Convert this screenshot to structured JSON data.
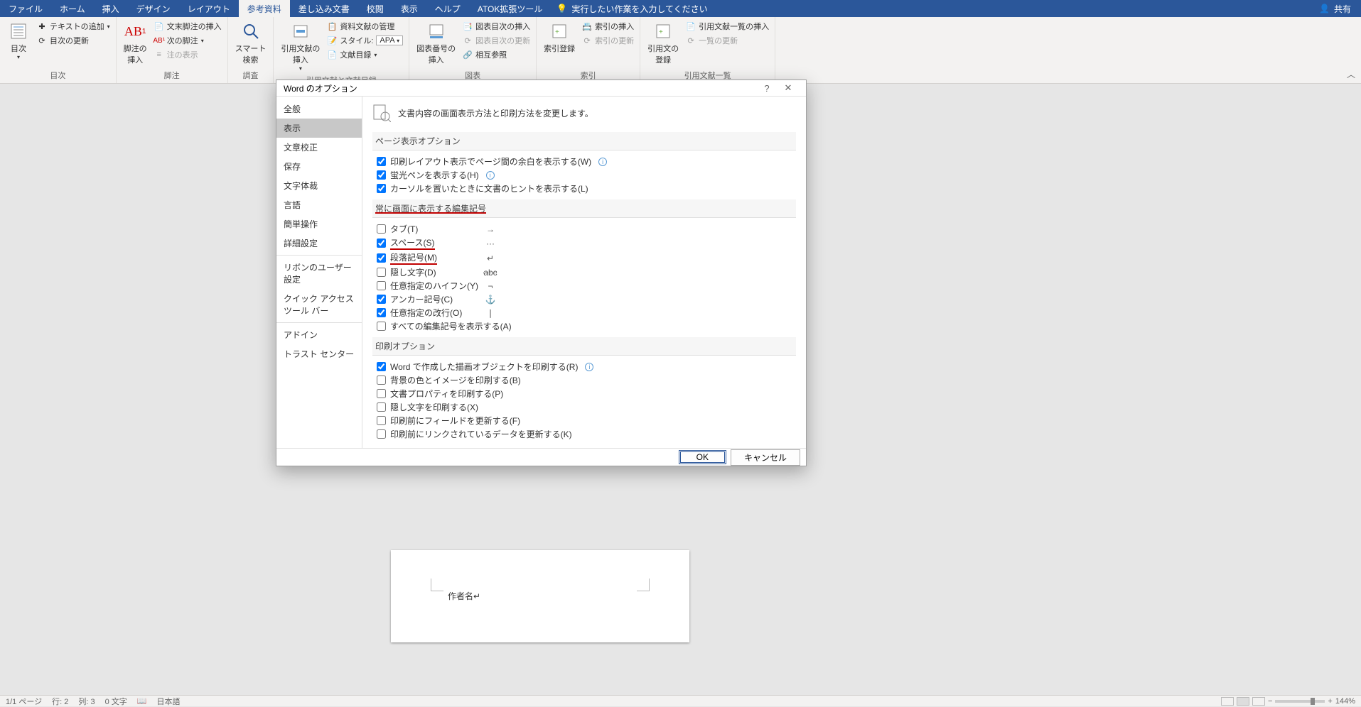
{
  "tabs": {
    "file": "ファイル",
    "home": "ホーム",
    "insert": "挿入",
    "design": "デザイン",
    "layout": "レイアウト",
    "references": "参考資料",
    "mailings": "差し込み文書",
    "review": "校閲",
    "view": "表示",
    "help": "ヘルプ",
    "atok": "ATOK拡張ツール",
    "search_placeholder": "実行したい作業を入力してください",
    "share": "共有"
  },
  "ribbon": {
    "toc": {
      "toc_btn": "目次",
      "add_text": "テキストの追加",
      "update_toc": "目次の更新",
      "group": "目次"
    },
    "footnotes": {
      "insert_footnote": "脚注の\n挿入",
      "insert_endnote": "文末脚注の挿入",
      "next_footnote": "次の脚注",
      "show_notes": "注の表示",
      "group": "脚注"
    },
    "research": {
      "smart_lookup": "スマート\n検索",
      "group": "調査"
    },
    "citations": {
      "insert_citation": "引用文献の\n挿入",
      "manage_sources": "資料文献の管理",
      "style_label": "スタイル:",
      "style_value": "APA",
      "bibliography": "文献目録",
      "group": "引用文献と文献目録"
    },
    "captions": {
      "insert_caption": "図表番号の\n挿入",
      "insert_table_figures": "図表目次の挿入",
      "update_table_figures": "図表目次の更新",
      "cross_reference": "相互参照",
      "group": "図表"
    },
    "index": {
      "mark_entry": "索引登録",
      "insert_index": "索引の挿入",
      "update_index": "索引の更新",
      "group": "索引"
    },
    "authorities": {
      "mark_citation": "引用文の\n登録",
      "insert_toa": "引用文献一覧の挿入",
      "update_toa": "一覧の更新",
      "group": "引用文献一覧"
    }
  },
  "dialog": {
    "title": "Word のオプション",
    "nav": {
      "general": "全般",
      "display": "表示",
      "proofing": "文章校正",
      "save": "保存",
      "typography": "文字体裁",
      "language": "言語",
      "ease": "簡単操作",
      "advanced": "詳細設定",
      "customize_ribbon": "リボンのユーザー設定",
      "qat": "クイック アクセス ツール バー",
      "addins": "アドイン",
      "trust": "トラスト センター"
    },
    "heading": "文書内容の画面表示方法と印刷方法を変更します。",
    "sections": {
      "page_display": "ページ表示オプション",
      "formatting_marks": "常に画面に表示する編集記号",
      "printing": "印刷オプション"
    },
    "page_display": {
      "whitespace": "印刷レイアウト表示でページ間の余白を表示する(W)",
      "highlighter": "蛍光ペンを表示する(H)",
      "tooltips": "カーソルを置いたときに文書のヒントを表示する(L)"
    },
    "marks": {
      "tab": "タブ(T)",
      "space": "スペース(S)",
      "paragraph": "段落記号(M)",
      "hidden": "隠し文字(D)",
      "opt_hyphen": "任意指定のハイフン(Y)",
      "anchor": "アンカー記号(C)",
      "opt_break": "任意指定の改行(O)",
      "all": "すべての編集記号を表示する(A)"
    },
    "mark_symbols": {
      "tab": "→",
      "space": "···",
      "paragraph": "↵",
      "hidden": "abc",
      "opt_hyphen": "¬",
      "anchor": "⚓",
      "opt_break": "❘"
    },
    "printing": {
      "drawings": "Word で作成した描画オブジェクトを印刷する(R)",
      "background": "背景の色とイメージを印刷する(B)",
      "properties": "文書プロパティを印刷する(P)",
      "hidden_text": "隠し文字を印刷する(X)",
      "update_fields": "印刷前にフィールドを更新する(F)",
      "update_links": "印刷前にリンクされているデータを更新する(K)"
    },
    "buttons": {
      "ok": "OK",
      "cancel": "キャンセル"
    }
  },
  "document": {
    "field_author": "作者名↵"
  },
  "status": {
    "page": "1/1 ページ",
    "line": "行: 2",
    "col": "列: 3",
    "words": "0 文字",
    "lang": "日本語",
    "zoom": "144%"
  }
}
